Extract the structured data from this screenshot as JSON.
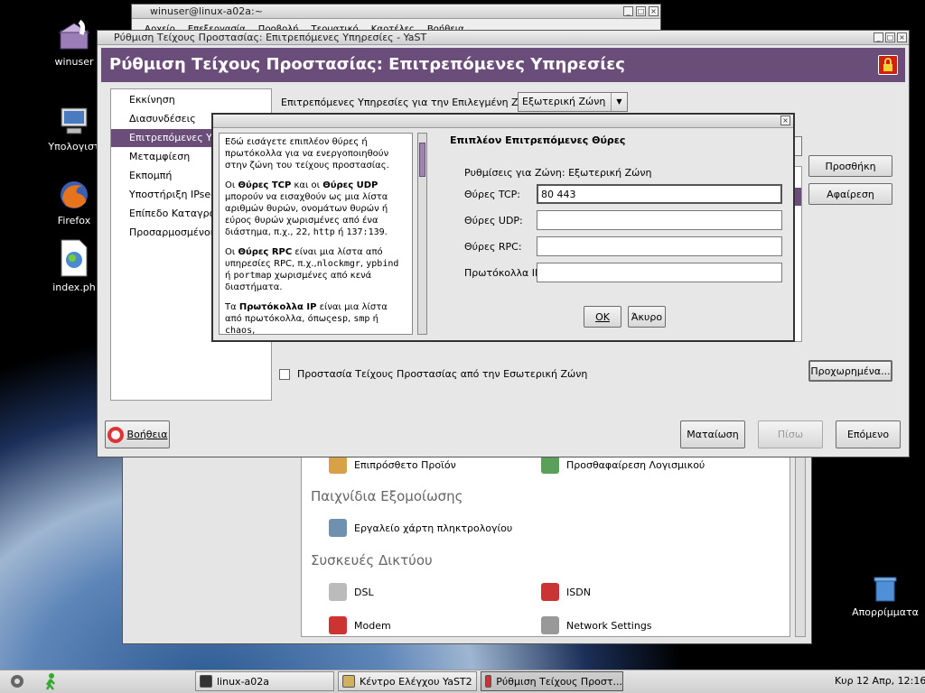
{
  "desktop": {
    "icons": [
      {
        "label": "winuser",
        "icon": "home-folder-icon"
      },
      {
        "label": "Υπολογιστ",
        "icon": "computer-icon"
      },
      {
        "label": "Firefox",
        "icon": "firefox-icon"
      },
      {
        "label": "index.ph",
        "icon": "php-file-icon"
      },
      {
        "label": "Απορρίμματα",
        "icon": "trash-icon"
      }
    ]
  },
  "terminal_window": {
    "title": "winuser@linux-a02a:~",
    "menu": [
      "Αρχείο",
      "Επεξεργασία",
      "Προβολή",
      "Τερματικό",
      "Καρτέλες",
      "Βοήθεια"
    ]
  },
  "control_center": {
    "items_top": [
      {
        "label": "Επιπρόσθετο Προϊόν",
        "icon": "addon-icon"
      },
      {
        "label": "Προσθαφαίρεση Λογισμικού",
        "icon": "software-icon"
      }
    ],
    "section_games": "Παιχνίδια Εξομοίωσης",
    "items_games": [
      {
        "label": "Εργαλείο χάρτη πληκτρολογίου",
        "icon": "keyboard-map-icon"
      }
    ],
    "section_network": "Συσκευές Δικτύου",
    "items_network": [
      {
        "label": "DSL",
        "icon": "dsl-icon"
      },
      {
        "label": "ISDN",
        "icon": "isdn-icon"
      },
      {
        "label": "Modem",
        "icon": "modem-icon"
      },
      {
        "label": "Network Settings",
        "icon": "network-settings-icon"
      }
    ]
  },
  "yast_window": {
    "title": "Ρύθμιση Τείχους Προστασίας: Επιτρεπόμενες Υπηρεσίες - YaST",
    "header": "Ρύθμιση Τείχους Προστασίας: Επιτρεπόμενες Υπηρεσίες",
    "nav": [
      "Εκκίνηση",
      "Διασυνδέσεις",
      "Επιτρεπόμενες Υπηρ",
      "Μεταμφίεση",
      "Εκπομπή",
      "Υποστήριξη IPsec",
      "Επίπεδο Καταγρα",
      "Προσαρμοσμένοι Κ"
    ],
    "nav_selected_index": 2,
    "zone_label": "Επιτρεπόμενες Υπηρεσίες για την Επιλεγμένη Ζώνη:",
    "zone_value": "Εξωτερική Ζώνη",
    "add_button": "Προσθήκη",
    "remove_button": "Αφαίρεση",
    "protect_checkbox_label": "Προστασία Τείχους Προστασίας από την Εσωτερική Ζώνη",
    "protect_checked": false,
    "advanced_button": "Προχωρημένα...",
    "help_button": "Βοήθεια",
    "cancel_button": "Ματαίωση",
    "back_button": "Πίσω",
    "next_button": "Επόμενο"
  },
  "dialog": {
    "title": "Επιπλέον Επιτρεπόμενες Θύρες",
    "zone_text": "Ρυθμίσεις για Ζώνη: Εξωτερική Ζώνη",
    "fields": [
      {
        "label": "Θύρες TCP:",
        "value": "80 443"
      },
      {
        "label": "Θύρες UDP:",
        "value": ""
      },
      {
        "label": "Θύρες RPC:",
        "value": ""
      },
      {
        "label": "Πρωτόκολλα IP:",
        "value": ""
      }
    ],
    "ok_button": "OK",
    "cancel_button": "Άκυρο",
    "help": {
      "p1": "Εδώ εισάγετε επιπλέον θύρες ή πρωτόκολλα για να ενεργοποιηθούν στην ζώνη του τείχους προστασίας.",
      "p2_a": "Οι ",
      "p2_b": "Θύρες TCP",
      "p2_c": " και οι ",
      "p2_d": "Θύρες UDP",
      "p2_e": " μπορούν να εισαχθούν ως μια λίστα αριθμών θυρών, ονομάτων θυρών ή εύρος θυρών χωρισμένες από ένα διάστημα, π.χ., 22, ",
      "p2_f": "http",
      "p2_g": " ή ",
      "p2_h": "137:139",
      "p2_i": ".",
      "p3_a": "Οι ",
      "p3_b": "Θύρες RPC",
      "p3_c": "  είναι μια λίστα από υπηρεσίες RPC, π.χ.,",
      "p3_d": "nlockmgr",
      "p3_e": ", ",
      "p3_f": "ypbind",
      "p3_g": " ή ",
      "p3_h": "portmap",
      "p3_i": " χωρισμένες από κενά διαστήματα.",
      "p4_a": "Τα ",
      "p4_b": "Πρωτόκολλα IP",
      "p4_c": " είναι μια λίστα από πρωτόκολλα, όπως",
      "p4_d": "esp",
      "p4_e": ", ",
      "p4_f": "smp",
      "p4_g": " ή ",
      "p4_h": "chaos",
      "p4_i": ","
    }
  },
  "taskbar": {
    "tasks": [
      {
        "label": "linux-a02a",
        "active": false
      },
      {
        "label": "Κέντρο Ελέγχου YaST2",
        "active": false
      },
      {
        "label": "Ρύθμιση Τείχους Προστ...",
        "active": true
      }
    ],
    "clock": "Κυρ 12 Απρ, 12:16"
  }
}
